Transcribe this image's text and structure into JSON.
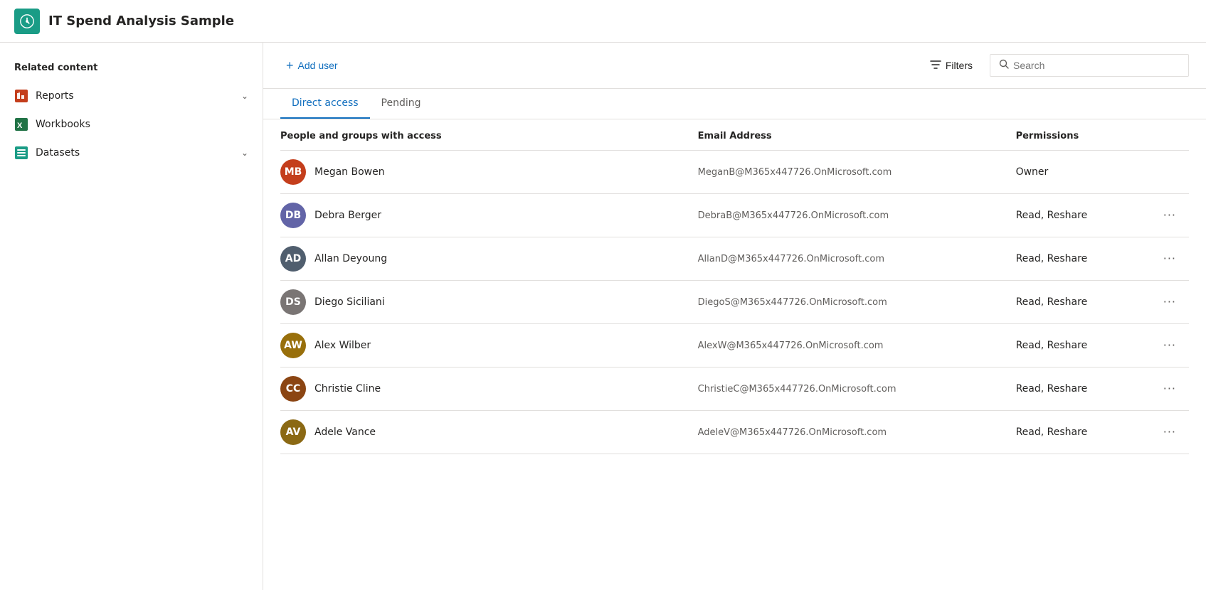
{
  "header": {
    "title": "IT Spend Analysis Sample",
    "icon_alt": "Power BI icon"
  },
  "sidebar": {
    "section_title": "Related content",
    "items": [
      {
        "id": "reports",
        "label": "Reports",
        "icon": "reports-icon",
        "has_chevron": true
      },
      {
        "id": "workbooks",
        "label": "Workbooks",
        "icon": "workbooks-icon",
        "has_chevron": false
      },
      {
        "id": "datasets",
        "label": "Datasets",
        "icon": "datasets-icon",
        "has_chevron": true
      }
    ]
  },
  "toolbar": {
    "add_user_label": "Add user",
    "filters_label": "Filters",
    "search_placeholder": "Search"
  },
  "tabs": [
    {
      "id": "direct-access",
      "label": "Direct access",
      "active": true
    },
    {
      "id": "pending",
      "label": "Pending",
      "active": false
    }
  ],
  "table": {
    "columns": [
      {
        "id": "people",
        "label": "People and groups with access"
      },
      {
        "id": "email",
        "label": "Email Address"
      },
      {
        "id": "permissions",
        "label": "Permissions"
      }
    ],
    "rows": [
      {
        "name": "Megan Bowen",
        "email": "MeganB@M365x447726.OnMicrosoft.com",
        "permissions": "Owner",
        "has_more": false,
        "avatar_color": "#c43e1c",
        "initials": "MB"
      },
      {
        "name": "Debra Berger",
        "email": "DebraB@M365x447726.OnMicrosoft.com",
        "permissions": "Read, Reshare",
        "has_more": true,
        "avatar_color": "#6264a7",
        "initials": "DB"
      },
      {
        "name": "Allan Deyoung",
        "email": "AllanD@M365x447726.OnMicrosoft.com",
        "permissions": "Read, Reshare",
        "has_more": true,
        "avatar_color": "#505e6e",
        "initials": "AD"
      },
      {
        "name": "Diego Siciliani",
        "email": "DiegoS@M365x447726.OnMicrosoft.com",
        "permissions": "Read, Reshare",
        "has_more": true,
        "avatar_color": "#7a7574",
        "initials": "DS"
      },
      {
        "name": "Alex Wilber",
        "email": "AlexW@M365x447726.OnMicrosoft.com",
        "permissions": "Read, Reshare",
        "has_more": true,
        "avatar_color": "#986f0b",
        "initials": "AW"
      },
      {
        "name": "Christie Cline",
        "email": "ChristieC@M365x447726.OnMicrosoft.com",
        "permissions": "Read, Reshare",
        "has_more": true,
        "avatar_color": "#8b4513",
        "initials": "CC"
      },
      {
        "name": "Adele Vance",
        "email": "AdeleV@M365x447726.OnMicrosoft.com",
        "permissions": "Read, Reshare",
        "has_more": true,
        "avatar_color": "#8b6914",
        "initials": "AV"
      }
    ]
  }
}
